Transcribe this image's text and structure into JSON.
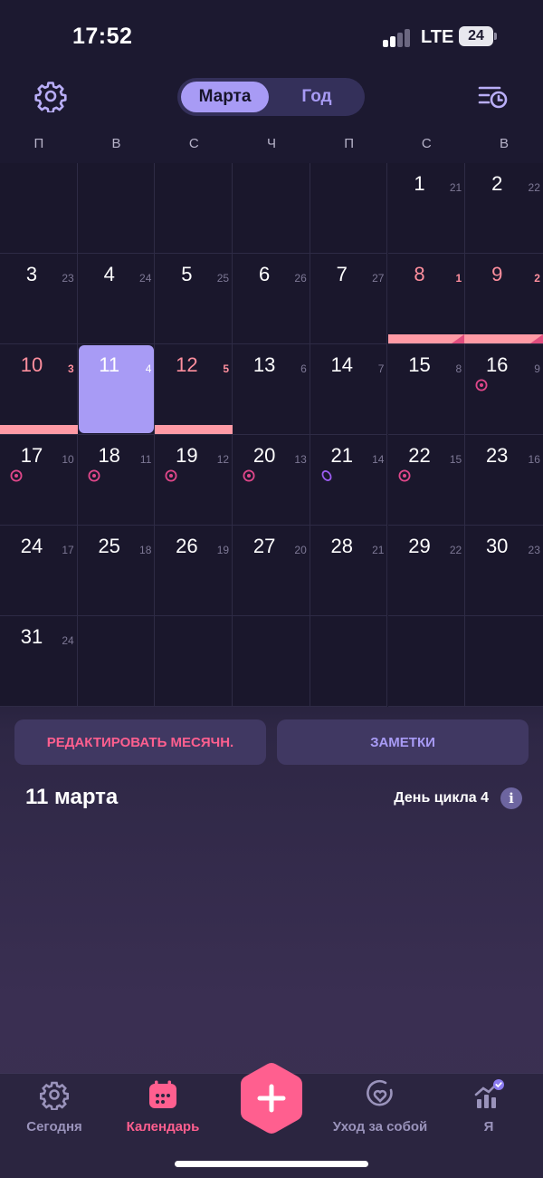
{
  "status_bar": {
    "time": "17:52",
    "network": "LTE",
    "battery": "24"
  },
  "header": {
    "segments": [
      "Марта",
      "Год"
    ],
    "active_segment": "Марта",
    "icons": [
      "gear-icon",
      "history-list-icon"
    ]
  },
  "weekdays": [
    "П",
    "В",
    "С",
    "Ч",
    "П",
    "С",
    "В"
  ],
  "calendar": {
    "cells": [
      {
        "day": "",
        "cycle": ""
      },
      {
        "day": "",
        "cycle": ""
      },
      {
        "day": "",
        "cycle": ""
      },
      {
        "day": "",
        "cycle": ""
      },
      {
        "day": "",
        "cycle": ""
      },
      {
        "day": "1",
        "cycle": "21"
      },
      {
        "day": "2",
        "cycle": "22"
      },
      {
        "day": "3",
        "cycle": "23"
      },
      {
        "day": "4",
        "cycle": "24"
      },
      {
        "day": "5",
        "cycle": "25"
      },
      {
        "day": "6",
        "cycle": "26"
      },
      {
        "day": "7",
        "cycle": "27"
      },
      {
        "day": "8",
        "cycle": "1",
        "period": true
      },
      {
        "day": "9",
        "cycle": "2",
        "period": true
      },
      {
        "day": "10",
        "cycle": "3",
        "period": true
      },
      {
        "day": "11",
        "cycle": "4",
        "selected": true
      },
      {
        "day": "12",
        "cycle": "5",
        "period": true
      },
      {
        "day": "13",
        "cycle": "6"
      },
      {
        "day": "14",
        "cycle": "7"
      },
      {
        "day": "15",
        "cycle": "8"
      },
      {
        "day": "16",
        "cycle": "9",
        "marker": "fertile-icon"
      },
      {
        "day": "17",
        "cycle": "10",
        "marker": "fertile-icon"
      },
      {
        "day": "18",
        "cycle": "11",
        "marker": "fertile-icon"
      },
      {
        "day": "19",
        "cycle": "12",
        "marker": "fertile-icon"
      },
      {
        "day": "20",
        "cycle": "13",
        "marker": "fertile-icon"
      },
      {
        "day": "21",
        "cycle": "14",
        "marker": "ovulation-icon"
      },
      {
        "day": "22",
        "cycle": "15",
        "marker": "fertile-icon"
      },
      {
        "day": "23",
        "cycle": "16"
      },
      {
        "day": "24",
        "cycle": "17"
      },
      {
        "day": "25",
        "cycle": "18"
      },
      {
        "day": "26",
        "cycle": "19"
      },
      {
        "day": "27",
        "cycle": "20"
      },
      {
        "day": "28",
        "cycle": "21"
      },
      {
        "day": "29",
        "cycle": "22"
      },
      {
        "day": "30",
        "cycle": "23"
      },
      {
        "day": "31",
        "cycle": "24"
      },
      {
        "day": "",
        "cycle": ""
      },
      {
        "day": "",
        "cycle": ""
      },
      {
        "day": "",
        "cycle": ""
      },
      {
        "day": "",
        "cycle": ""
      },
      {
        "day": "",
        "cycle": ""
      },
      {
        "day": "",
        "cycle": ""
      }
    ],
    "period_bars": [
      {
        "cell": 12,
        "cap": true
      },
      {
        "cell": 13,
        "cap": true
      },
      {
        "cell": 14,
        "cap": false
      },
      {
        "cell": 16,
        "cap": false
      }
    ]
  },
  "actions": {
    "edit_label": "РЕДАКТИРОВАТЬ МЕСЯЧН.",
    "notes_label": "ЗАМЕТКИ"
  },
  "details": {
    "date": "11 марта",
    "cycle_day": "День цикла 4",
    "info_icon": "i"
  },
  "tabbar": {
    "tabs": [
      {
        "label": "Сегодня",
        "icon": "flower-icon"
      },
      {
        "label": "Календарь",
        "icon": "calendar-icon",
        "active": true
      },
      {
        "label": "Уход за собой",
        "icon": "heart-circle-icon"
      },
      {
        "label": "Я",
        "icon": "chart-badge-icon"
      }
    ],
    "add_label": "+"
  },
  "colors": {
    "accent": "#a89bf5",
    "period": "#ff9aa5",
    "pink": "#ff5f8f",
    "fertile": "#e0478a",
    "ovulation": "#9b5cf0"
  }
}
